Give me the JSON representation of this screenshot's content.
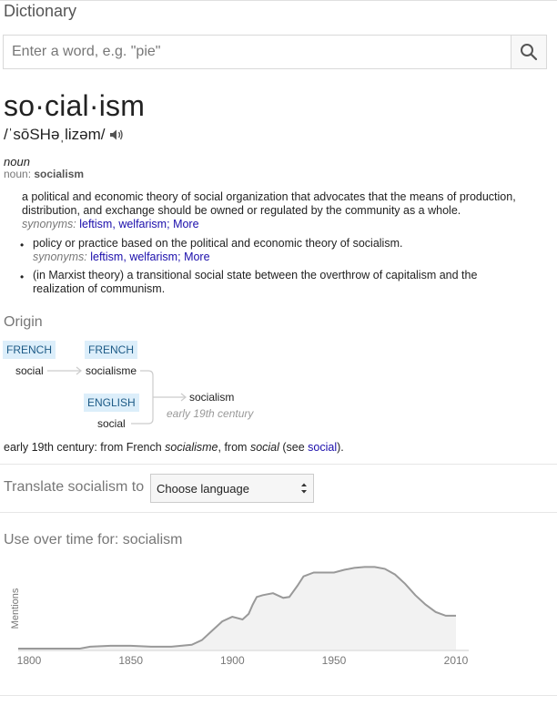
{
  "app": {
    "title": "Dictionary"
  },
  "search": {
    "placeholder": "Enter a word, e.g. \"pie\""
  },
  "entry": {
    "headword": "so·cial·ism",
    "phonetic": "/ˈsōSHəˌlizəm/",
    "part_of_speech": "noun",
    "inflection_label": "noun:",
    "inflection_word": "socialism",
    "senses": [
      {
        "line1": "a political and economic theory of social organization that advocates that the means of production,",
        "line2": "distribution, and exchange should be owned or regulated by the community as a whole.",
        "synonyms_label": "synonyms:",
        "synonyms": [
          "leftism,",
          "welfarism;"
        ],
        "more": "More"
      },
      {
        "line1": "policy or practice based on the political and economic theory of socialism.",
        "synonyms_label": "synonyms:",
        "synonyms": [
          "leftism,",
          "welfarism;"
        ],
        "more": "More"
      },
      {
        "line1": "(in Marxist theory) a transitional social state between the overthrow of capitalism and the",
        "line2": "realization of communism."
      }
    ]
  },
  "origin": {
    "title": "Origin",
    "tags": [
      "FRENCH",
      "FRENCH",
      "ENGLISH"
    ],
    "words": [
      "social",
      "socialisme",
      "social",
      "socialism"
    ],
    "date": "early 19th century",
    "text_prefix": "early 19th century: from French ",
    "text_italic1": "socialisme",
    "text_mid": ", from ",
    "text_italic2": "social",
    "text_see": " (see ",
    "text_link": "social",
    "text_end": ")."
  },
  "translate": {
    "label": "Translate socialism to",
    "selected": "Choose language"
  },
  "usage": {
    "title": "Use over time for: socialism",
    "ylabel": "Mentions"
  },
  "chart_data": {
    "type": "area",
    "title": "Use over time for: socialism",
    "xlabel": "",
    "ylabel": "Mentions",
    "x_ticks": [
      1800,
      1850,
      1900,
      1950,
      2010
    ],
    "xlim": [
      1800,
      2010
    ],
    "ylim": [
      0,
      100
    ],
    "grid": false,
    "series": [
      {
        "x": [
          1793,
          1825,
          1830,
          1840,
          1850,
          1860,
          1870,
          1880,
          1885,
          1890,
          1895,
          1900,
          1905,
          1908,
          1910,
          1912,
          1915,
          1920,
          1925,
          1928,
          1932,
          1935,
          1940,
          1945,
          1950,
          1955,
          1960,
          1965,
          1970,
          1975,
          1980,
          1985,
          1990,
          1995,
          2000,
          2005,
          2010
        ],
        "values": [
          1,
          1,
          3,
          4,
          4,
          3,
          3,
          5,
          10,
          20,
          30,
          35,
          32,
          38,
          48,
          56,
          58,
          60,
          55,
          56,
          68,
          78,
          82,
          82,
          82,
          85,
          87,
          88,
          88,
          86,
          80,
          70,
          58,
          48,
          40,
          36,
          36
        ]
      }
    ]
  }
}
